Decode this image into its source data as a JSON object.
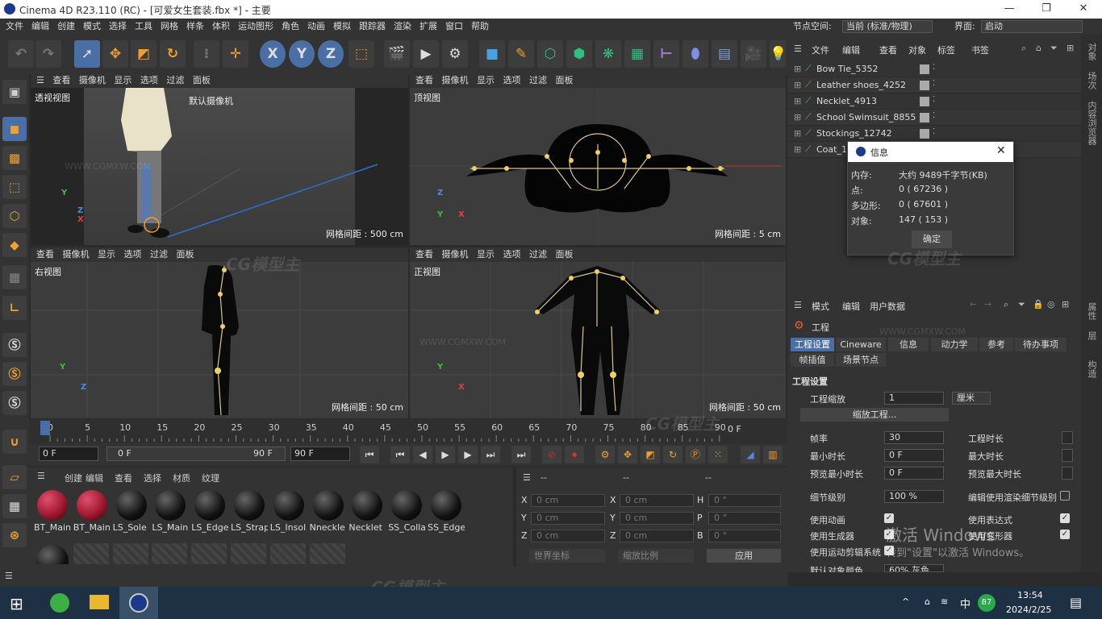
{
  "window": {
    "title": "Cinema 4D R23.110 (RC) - [可爱女生套装.fbx *] - 主要",
    "minimize": "—",
    "maximize": "❐",
    "close": "✕"
  },
  "menubar": {
    "items": [
      "文件",
      "编辑",
      "创建",
      "模式",
      "选择",
      "工具",
      "网格",
      "样条",
      "体积",
      "运动图形",
      "角色",
      "动画",
      "模拟",
      "跟踪器",
      "渲染",
      "扩展",
      "窗口",
      "帮助"
    ],
    "node_space_label": "节点空间:",
    "node_space_value": "当前 (标准/物理)",
    "layout_label": "界面:",
    "layout_value": "启动"
  },
  "toolbar": {
    "xyz": [
      "X",
      "Y",
      "Z"
    ]
  },
  "viewports": {
    "menu": [
      "查看",
      "摄像机",
      "显示",
      "选项",
      "过滤",
      "面板"
    ],
    "perspective": {
      "name": "透视视图",
      "camera": "默认摄像机",
      "grid": "网格间距 : 500 cm"
    },
    "top": {
      "name": "顶视图",
      "grid": "网格间距 : 5 cm"
    },
    "right": {
      "name": "右视图",
      "grid": "网格间距 : 50 cm"
    },
    "front": {
      "name": "正视图",
      "grid": "网格间距 : 50 cm"
    }
  },
  "axes": {
    "x": "X",
    "y": "Y",
    "z": "Z"
  },
  "timeline": {
    "ticks": [
      "0",
      "5",
      "10",
      "15",
      "20",
      "25",
      "30",
      "35",
      "40",
      "45",
      "50",
      "55",
      "60",
      "65",
      "70",
      "75",
      "80",
      "85",
      "90"
    ],
    "end_label": "0 F"
  },
  "playback": {
    "start": "0 F",
    "current": "0 F",
    "range_end": "90 F",
    "end": "90 F"
  },
  "materials": {
    "menu": [
      "创建",
      "编辑",
      "查看",
      "选择",
      "材质",
      "纹理"
    ],
    "items": [
      "BT_Main",
      "BT_Main",
      "LS_Sole",
      "LS_Main",
      "LS_Edge",
      "LS_Strap",
      "LS_Insol",
      "Nneckle",
      "Necklet",
      "SS_Colla",
      "SS_Edge"
    ]
  },
  "coords": {
    "headers": [
      "--",
      "--",
      "--"
    ],
    "rows": [
      {
        "a": "X",
        "av": "0 cm",
        "b": "X",
        "bv": "0 cm",
        "c": "H",
        "cv": "0 °"
      },
      {
        "a": "Y",
        "av": "0 cm",
        "b": "Y",
        "bv": "0 cm",
        "c": "P",
        "cv": "0 °"
      },
      {
        "a": "Z",
        "av": "0 cm",
        "b": "Z",
        "bv": "0 cm",
        "c": "B",
        "cv": "0 °"
      }
    ],
    "world": "世界坐标",
    "scale": "缩放比例",
    "apply": "应用"
  },
  "objects": {
    "menu": [
      "文件",
      "编辑",
      "查看",
      "对象",
      "标签",
      "书签"
    ],
    "rows": [
      "Bow Tie_5352",
      "Leather shoes_4252",
      "Necklet_4913",
      "School Swimsuit_8855",
      "Stockings_12742",
      "Coat_1"
    ]
  },
  "info_dialog": {
    "title": "信息",
    "rows": [
      {
        "k": "内存:",
        "v": "大约 9489千字节(KB)"
      },
      {
        "k": "点:",
        "v": "0 ( 67236 )"
      },
      {
        "k": "多边形:",
        "v": "0 ( 67601 )"
      },
      {
        "k": "对象:",
        "v": "147 ( 153 )"
      }
    ],
    "ok": "确定"
  },
  "attributes": {
    "menu": [
      "模式",
      "编辑",
      "用户数据"
    ],
    "object": "工程",
    "tabs": [
      "工程设置",
      "Cineware",
      "信息",
      "动力学",
      "参考",
      "待办事项"
    ],
    "tabs2": [
      "帧插值",
      "场景节点"
    ],
    "section": "工程设置",
    "scale_label": "工程缩放",
    "scale_value": "1",
    "scale_unit": "厘米",
    "scale_btn": "缩放工程...",
    "fps_label": "帧率",
    "fps_value": "30",
    "duration_label": "工程时长",
    "min_label": "最小时长",
    "min_value": "0 F",
    "max_label": "最大时长",
    "pmin_label": "预览最小时长",
    "pmin_value": "0 F",
    "pmax_label": "预览最大时长",
    "lod_label": "细节级别",
    "lod_value": "100 %",
    "lod_render_label": "编辑使用渲染细节级别",
    "anim_label": "使用动画",
    "expr_label": "使用表达式",
    "gen_label": "使用生成器",
    "deform_label": "使用变形器",
    "motion_label": "使用运动剪辑系统",
    "color_label": "默认对象颜色",
    "color_value": "60% 灰色"
  },
  "side_tabs": {
    "right1": [
      "对象",
      "场次",
      "内容浏览器"
    ],
    "right2": [
      "属性",
      "层",
      "构造"
    ]
  },
  "activation": {
    "line1": "激活 Windows",
    "line2": "转到\"设置\"以激活 Windows。"
  },
  "watermark": {
    "logo": "CG模型主",
    "url": "WWW.CGMXW.COM"
  },
  "taskbar": {
    "time": "13:54",
    "date": "2024/2/25",
    "ime": "中",
    "badge": "87"
  }
}
